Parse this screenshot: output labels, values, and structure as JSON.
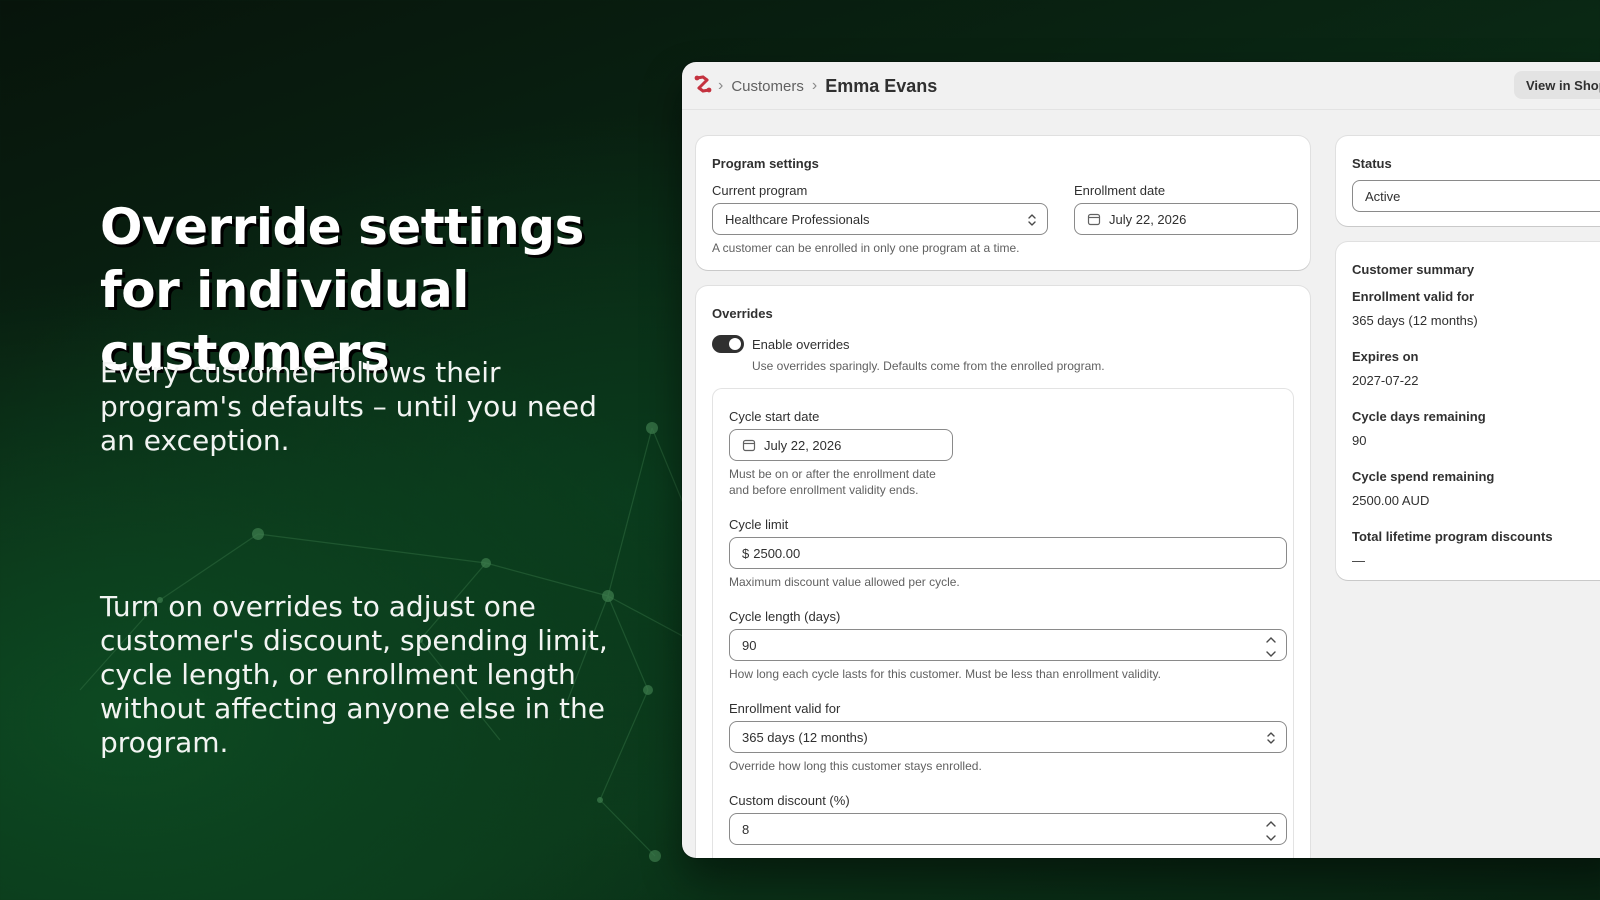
{
  "hero": {
    "title": "Override settings for individual customers",
    "paragraph_1": "Every customer follows their program's defaults – until you need an exception.",
    "paragraph_2": "Turn on overrides to adjust one customer's discount, spending limit, cycle length, or enrollment length without affecting anyone else in the program."
  },
  "header": {
    "breadcrumb": [
      "Customers",
      "Emma Evans"
    ],
    "view_button": "View in Shopify"
  },
  "program_settings": {
    "title": "Program settings",
    "current_program_label": "Current program",
    "current_program_value": "Healthcare Professionals",
    "enrollment_date_label": "Enrollment date",
    "enrollment_date_value": "July 22, 2026",
    "help": "A customer can be enrolled in only one program at a time."
  },
  "overrides": {
    "title": "Overrides",
    "toggle_label": "Enable overrides",
    "toggle_on": true,
    "toggle_help": "Use overrides sparingly. Defaults come from the enrolled program.",
    "cycle_start_label": "Cycle start date",
    "cycle_start_value": "July 22, 2026",
    "cycle_start_help": "Must be on or after the enrollment date and before enrollment validity ends.",
    "cycle_limit_label": "Cycle limit",
    "cycle_limit_prefix": "$",
    "cycle_limit_value": "2500.00",
    "cycle_limit_help": "Maximum discount value allowed per cycle.",
    "cycle_length_label": "Cycle length (days)",
    "cycle_length_value": "90",
    "cycle_length_help": "How long each cycle lasts for this customer. Must be less than enrollment validity.",
    "validity_label": "Enrollment valid for",
    "validity_value": "365 days (12 months)",
    "validity_help": "Override how long this customer stays enrolled.",
    "discount_label": "Custom discount (%)",
    "discount_value": "8"
  },
  "status": {
    "title": "Status",
    "value": "Active"
  },
  "summary": {
    "title": "Customer summary",
    "items": [
      {
        "label": "Enrollment valid for",
        "value": "365 days (12 months)"
      },
      {
        "label": "Expires on",
        "value": "2027-07-22"
      },
      {
        "label": "Cycle days remaining",
        "value": "90"
      },
      {
        "label": "Cycle spend remaining",
        "value": "2500.00 AUD"
      },
      {
        "label": "Total lifetime program discounts",
        "value": "—"
      }
    ]
  },
  "colors": {
    "toggle_on": "#303030",
    "logo": "#c4323f",
    "background_dark": "#07140b",
    "background_green": "#0b3519"
  }
}
